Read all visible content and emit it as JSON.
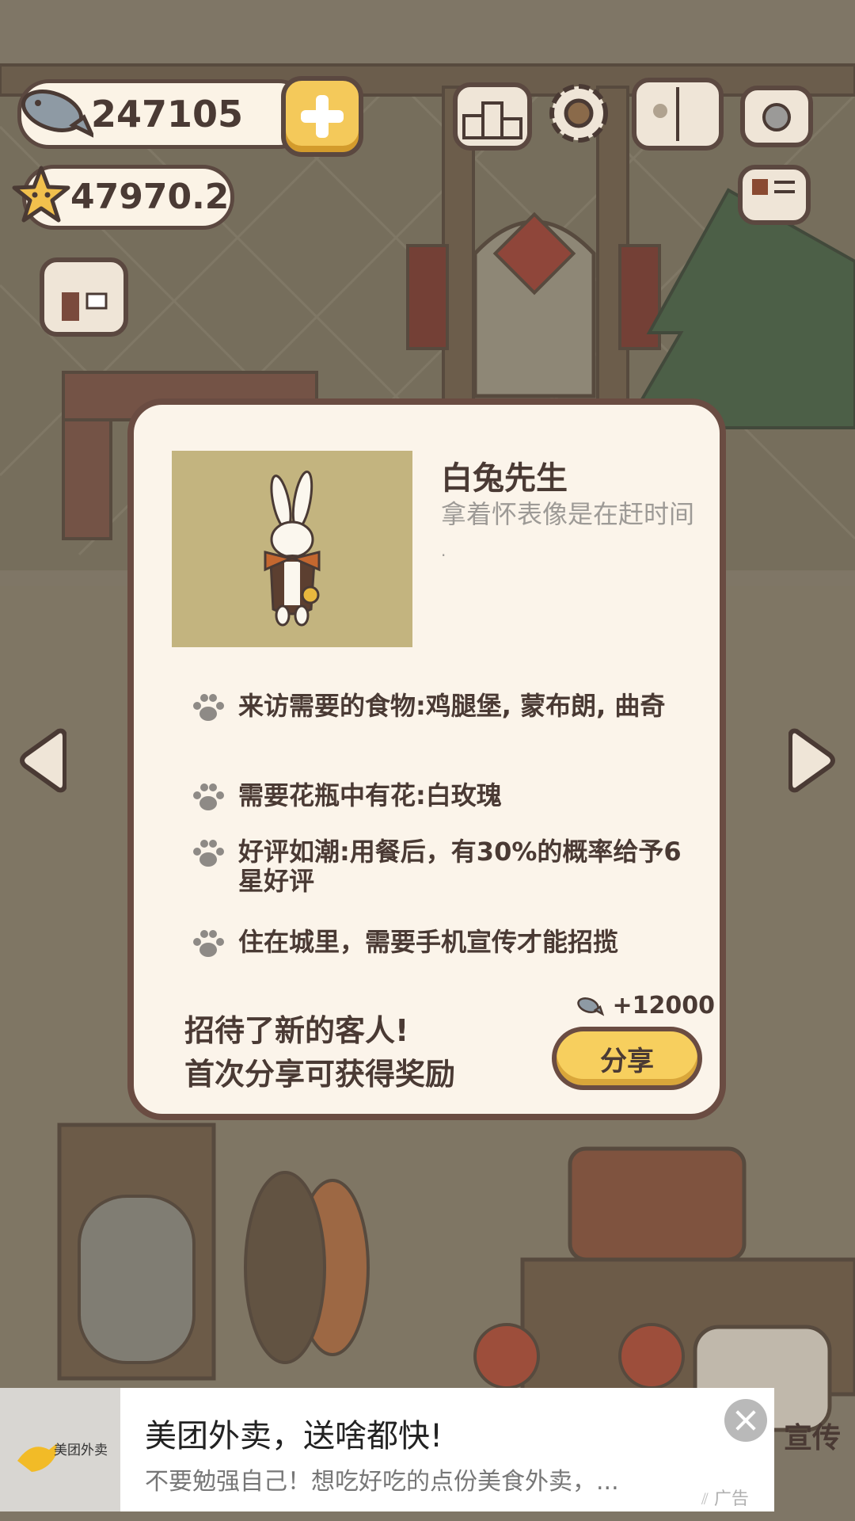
{
  "hud": {
    "fish_count": "247105",
    "star_count": "47970.2"
  },
  "modal": {
    "customer_name": "白兔先生",
    "customer_desc": "拿着怀表像是在赶时间",
    "customer_desc_dot": ".",
    "requirements": [
      {
        "text": "来访需要的食物:鸡腿堡, 蒙布朗, 曲奇"
      },
      {
        "text": "需要花瓶中有花:白玫瑰"
      },
      {
        "text": "好评如潮:用餐后，有30%的概率给予6星好评"
      },
      {
        "text": "住在城里，需要手机宣传才能招揽"
      }
    ],
    "welcome_line1": "招待了新的客人!",
    "welcome_line2": "首次分享可获得奖励",
    "reward": "+12000",
    "share_label": "分享"
  },
  "background": {
    "partial_button_label": "宣传"
  },
  "ad": {
    "brand": "美团外卖",
    "title": "美团外卖，送啥都快!",
    "body": "不要勉强自己！想吃好吃的点份美食外卖，...",
    "tag": "广告"
  },
  "colors": {
    "modal_bg": "#fbf4ea",
    "modal_border": "#6a4c42",
    "portrait_bg": "#c3b47f",
    "button_yellow": "#f7cf5e",
    "text_dark": "#4a3a34"
  }
}
